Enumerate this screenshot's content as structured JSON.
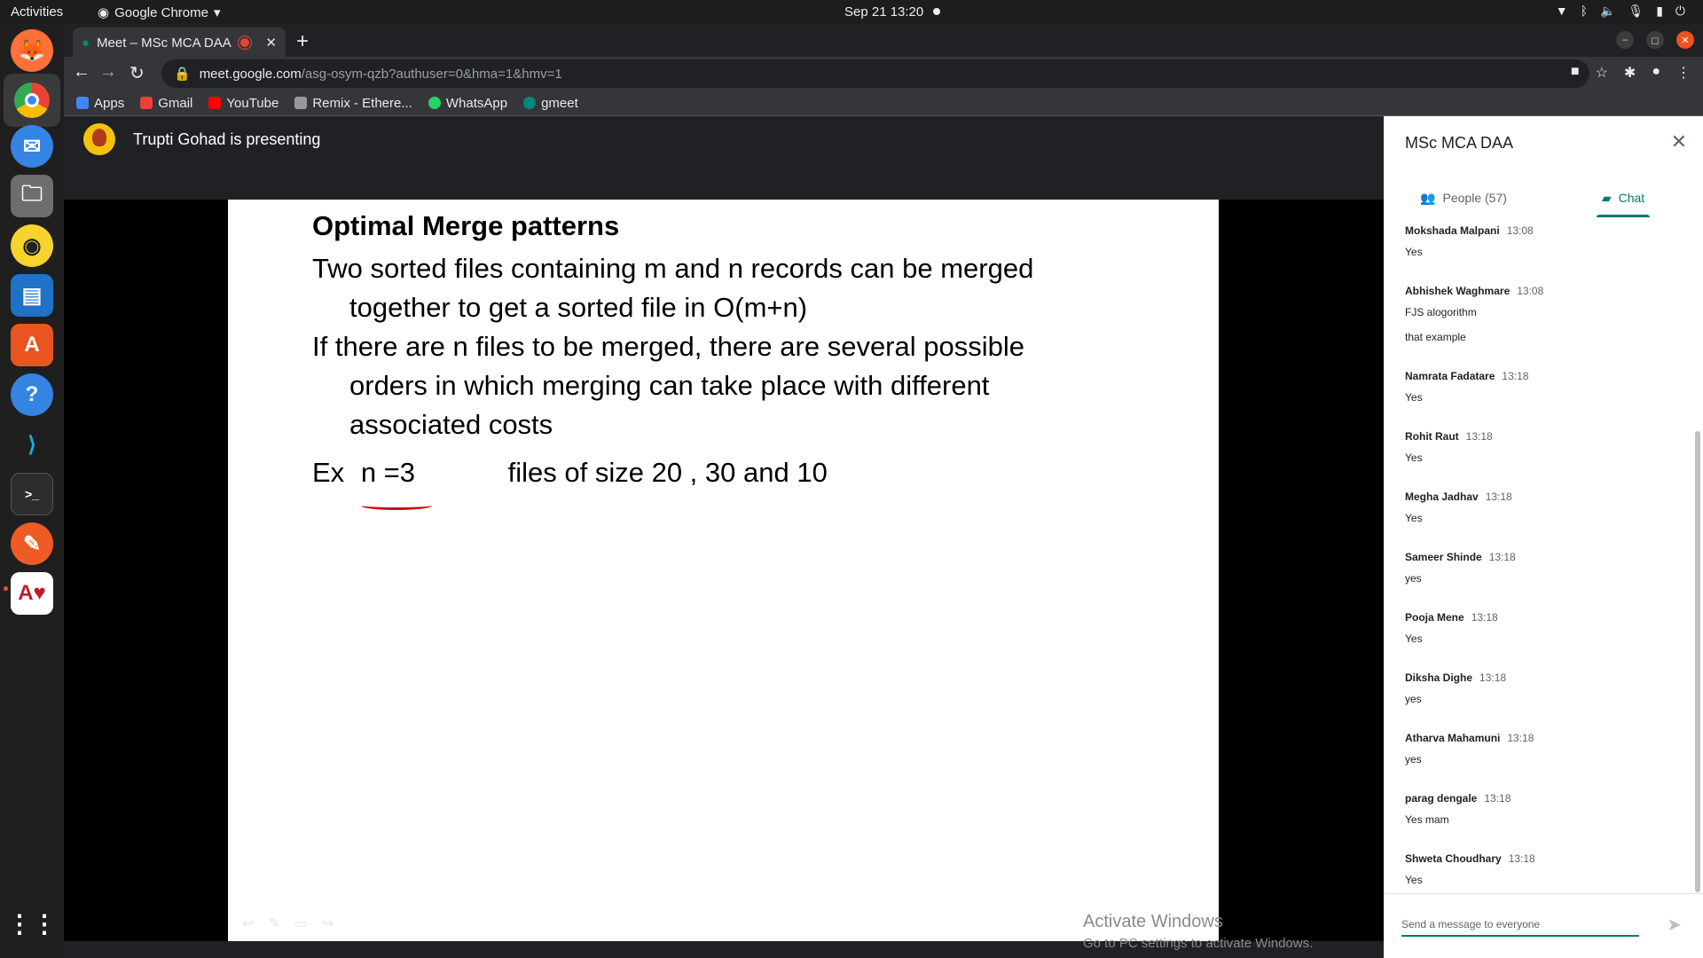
{
  "system": {
    "activities": "Activities",
    "app_name": "Google Chrome",
    "clock": "Sep 21  13:20"
  },
  "browser": {
    "tab_title": "Meet – MSc MCA DAA",
    "url_host": "meet.google.com",
    "url_path": "/asg-osym-qzb?authuser=0&hma=1&hmv=1",
    "bookmarks": [
      {
        "label": "Apps",
        "color": "#4285f4"
      },
      {
        "label": "Gmail",
        "color": "#ea4335"
      },
      {
        "label": "YouTube",
        "color": "#ff0000"
      },
      {
        "label": "Remix - Ethere...",
        "color": "#999999"
      },
      {
        "label": "WhatsApp",
        "color": "#25d366"
      },
      {
        "label": "gmeet",
        "color": "#00897b"
      }
    ]
  },
  "meet": {
    "presenter_text": "Trupti Gohad is presenting",
    "slide": {
      "title": "Optimal Merge patterns",
      "p1_line1": "Two sorted files containing m and n records can be merged",
      "p1_line2": "together to get a sorted file in O(m+n)",
      "p2_line1": "If there are n files to be merged, there are several possible",
      "p2_line2": "orders in which merging can take place with different",
      "p2_line3": "associated costs",
      "ex_label": "Ex",
      "ex_n": "n =3",
      "ex_rest": "files of size 20 , 30 and 10"
    },
    "watermark_line1": "Activate Windows",
    "watermark_line2": "Go to PC settings to activate Windows."
  },
  "panel": {
    "title": "MSc MCA DAA",
    "people_tab": "People (57)",
    "chat_tab": "Chat",
    "messages": [
      {
        "name": "Mokshada Malpani",
        "time": "13:08",
        "lines": [
          "Yes"
        ]
      },
      {
        "name": "Abhishek Waghmare",
        "time": "13:08",
        "lines": [
          "FJS alogorithm",
          "that example"
        ]
      },
      {
        "name": "Namrata Fadatare",
        "time": "13:18",
        "lines": [
          "Yes"
        ]
      },
      {
        "name": "Rohit Raut",
        "time": "13:18",
        "lines": [
          "Yes"
        ]
      },
      {
        "name": "Megha Jadhav",
        "time": "13:18",
        "lines": [
          "Yes"
        ]
      },
      {
        "name": "Sameer Shinde",
        "time": "13:18",
        "lines": [
          "yes"
        ]
      },
      {
        "name": "Pooja Mene",
        "time": "13:18",
        "lines": [
          "Yes"
        ]
      },
      {
        "name": "Diksha Dighe",
        "time": "13:18",
        "lines": [
          "yes"
        ]
      },
      {
        "name": "Atharva Mahamuni",
        "time": "13:18",
        "lines": [
          "yes"
        ]
      },
      {
        "name": "parag dengale",
        "time": "13:18",
        "lines": [
          "Yes mam"
        ]
      },
      {
        "name": "Shweta Choudhary",
        "time": "13:18",
        "lines": [
          "Yes"
        ]
      }
    ],
    "composer_placeholder": "Send a message to everyone"
  },
  "colors": {
    "accent": "#00796b",
    "ubuntu_orange": "#e95420",
    "annotation_red": "#d00000"
  }
}
